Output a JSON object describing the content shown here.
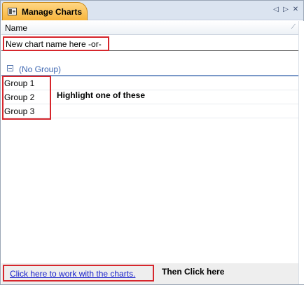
{
  "window": {
    "tab_title": "Manage Charts",
    "buttons": {
      "prev": "◁",
      "next": "▷",
      "close": "✕"
    }
  },
  "list": {
    "column_header": "Name",
    "resize_glyph": "⁄",
    "new_chart_placeholder": "New chart name here -or-",
    "new_chart_value": "New chart name here -or-",
    "group_header": "(No Group)",
    "groups": [
      "Group 1",
      "Group 2",
      "Group 3"
    ]
  },
  "annotations": {
    "highlight_note": "Highlight one of these",
    "then_note": "Then Click here"
  },
  "footer": {
    "link_label": "Click here to work with the charts."
  },
  "colors": {
    "tab_accent": "#f7b43a",
    "annotation_border": "#d6262c",
    "group_header_text": "#3b65b1",
    "link": "#1a22cc"
  },
  "icons": {
    "tab_icon": "window-panel-icon",
    "collapse": "collapse-minus-icon"
  }
}
